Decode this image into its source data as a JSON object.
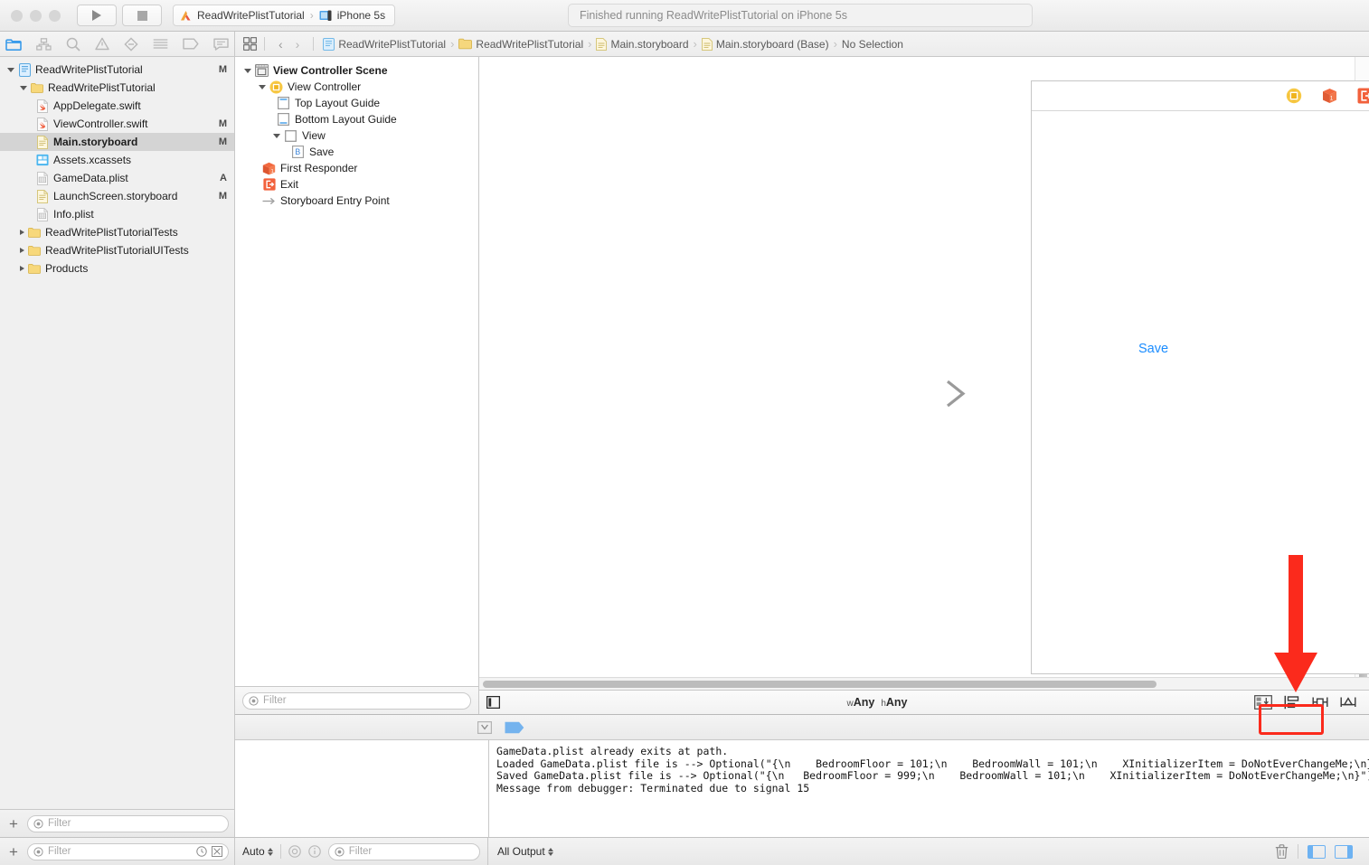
{
  "titlebar": {
    "scheme_project": "ReadWritePlistTutorial",
    "scheme_device": "iPhone 5s",
    "status_text": "Finished running ReadWritePlistTutorial on iPhone 5s",
    "run_button": "run-button",
    "stop_button": "stop-button"
  },
  "navigator_toolbar": {
    "items": [
      {
        "name": "folder-icon",
        "label": "Project navigator"
      },
      {
        "name": "hierarchy-icon",
        "label": "Source control navigator"
      },
      {
        "name": "search-icon",
        "label": "Find navigator"
      },
      {
        "name": "warning-triangle-icon",
        "label": "Issue navigator"
      },
      {
        "name": "diamond-icon",
        "label": "Test navigator"
      },
      {
        "name": "list-icon",
        "label": "Debug navigator"
      },
      {
        "name": "tag-icon",
        "label": "Breakpoint navigator"
      },
      {
        "name": "speech-bubble-icon",
        "label": "Report navigator"
      }
    ]
  },
  "breadcrumb": {
    "grid_button": "related-items",
    "back": "‹",
    "forward": "›",
    "items": [
      {
        "label": "ReadWritePlistTutorial",
        "icon": "project-icon"
      },
      {
        "label": "ReadWritePlistTutorial",
        "icon": "folder-icon"
      },
      {
        "label": "Main.storyboard",
        "icon": "storyboard-icon"
      },
      {
        "label": "Main.storyboard (Base)",
        "icon": "storyboard-icon"
      },
      {
        "label": "No Selection",
        "icon": "none"
      }
    ]
  },
  "navigator": {
    "filter_placeholder": "Filter",
    "items": [
      {
        "label": "ReadWritePlistTutorial",
        "indent": 0,
        "twisty": "open",
        "icon": "project-icon",
        "badge": "M",
        "selected": false
      },
      {
        "label": "ReadWritePlistTutorial",
        "indent": 1,
        "twisty": "open",
        "icon": "folder-icon",
        "badge": "",
        "selected": false
      },
      {
        "label": "AppDelegate.swift",
        "indent": 2,
        "twisty": "none",
        "icon": "swift-icon",
        "badge": "",
        "selected": false
      },
      {
        "label": "ViewController.swift",
        "indent": 2,
        "twisty": "none",
        "icon": "swift-icon",
        "badge": "M",
        "selected": false
      },
      {
        "label": "Main.storyboard",
        "indent": 2,
        "twisty": "none",
        "icon": "storyboard-icon",
        "badge": "M",
        "selected": true
      },
      {
        "label": "Assets.xcassets",
        "indent": 2,
        "twisty": "none",
        "icon": "assets-icon",
        "badge": "",
        "selected": false
      },
      {
        "label": "GameData.plist",
        "indent": 2,
        "twisty": "none",
        "icon": "plist-icon",
        "badge": "A",
        "selected": false
      },
      {
        "label": "LaunchScreen.storyboard",
        "indent": 2,
        "twisty": "none",
        "icon": "storyboard-icon",
        "badge": "M",
        "selected": false
      },
      {
        "label": "Info.plist",
        "indent": 2,
        "twisty": "none",
        "icon": "plist-icon",
        "badge": "",
        "selected": false
      },
      {
        "label": "ReadWritePlistTutorialTests",
        "indent": 1,
        "twisty": "closed",
        "icon": "folder-icon",
        "badge": "",
        "selected": false
      },
      {
        "label": "ReadWritePlistTutorialUITests",
        "indent": 1,
        "twisty": "closed",
        "icon": "folder-icon",
        "badge": "",
        "selected": false
      },
      {
        "label": "Products",
        "indent": 1,
        "twisty": "closed",
        "icon": "folder-icon",
        "badge": "",
        "selected": false
      }
    ]
  },
  "outline": {
    "filter_placeholder": "Filter",
    "items": [
      {
        "label": "View Controller Scene",
        "indent": 0,
        "twisty": "open",
        "icon": "scene-icon",
        "bold": true
      },
      {
        "label": "View Controller",
        "indent": 1,
        "twisty": "open",
        "icon": "view-controller-icon",
        "bold": false
      },
      {
        "label": "Top Layout Guide",
        "indent": 2,
        "twisty": "none",
        "icon": "top-layout-guide-icon",
        "bold": false
      },
      {
        "label": "Bottom Layout Guide",
        "indent": 2,
        "twisty": "none",
        "icon": "bottom-layout-guide-icon",
        "bold": false
      },
      {
        "label": "View",
        "indent": 2,
        "twisty": "open",
        "icon": "view-icon",
        "bold": false
      },
      {
        "label": "Save",
        "indent": 3,
        "twisty": "none",
        "icon": "button-icon",
        "bold": false
      },
      {
        "label": "First Responder",
        "indent": 1,
        "twisty": "none",
        "icon": "first-responder-icon",
        "bold": false
      },
      {
        "label": "Exit",
        "indent": 1,
        "twisty": "none",
        "icon": "exit-icon",
        "bold": false
      },
      {
        "label": "Storyboard Entry Point",
        "indent": 1,
        "twisty": "none",
        "icon": "entry-point-icon",
        "bold": false
      }
    ]
  },
  "canvas": {
    "save_button_label": "Save",
    "scene_dock": [
      {
        "name": "view-controller-dock-icon"
      },
      {
        "name": "first-responder-dock-icon"
      },
      {
        "name": "exit-dock-icon"
      }
    ],
    "entry_point_arrow": "storyboard-entry-arrow"
  },
  "ib_bottom_bar": {
    "left_icon": "document-outline-toggle",
    "size_class_w_prefix": "w",
    "size_class_w": "Any",
    "size_class_h_prefix": "h",
    "size_class_h": "Any",
    "right_icons": [
      {
        "name": "embed-in-icon",
        "highlighted": true
      },
      {
        "name": "align-icon",
        "highlighted": true
      },
      {
        "name": "pin-icon",
        "highlighted": false
      },
      {
        "name": "resolve-auto-layout-issues-icon",
        "highlighted": false
      }
    ],
    "annotation": {
      "type": "red-arrow-and-box",
      "color": "#fb2a1c"
    }
  },
  "debug": {
    "toolbar": [
      {
        "name": "debug-view-hierarchy-icon"
      },
      {
        "name": "breakpoint-icon"
      }
    ],
    "console_lines": [
      "GameData.plist already exits at path.",
      "Loaded GameData.plist file is --> Optional(\"{\\n    BedroomFloor = 101;\\n    BedroomWall = 101;\\n    XInitializerItem = DoNotEverChangeMe;\\n}\")",
      "Saved GameData.plist file is --> Optional(\"{\\n   BedroomFloor = 999;\\n    BedroomWall = 101;\\n    XInitializerItem = DoNotEverChangeMe;\\n}\")",
      "Message from debugger: Terminated due to signal 15"
    ]
  },
  "statusbar": {
    "add_button": "+",
    "nav_filter_placeholder": "Filter",
    "recent_icon": "clock-icon",
    "source_control_icon": "source-control-filter-icon",
    "scope_popup": "Auto",
    "target_icon": "target-icon",
    "info_icon": "info-icon",
    "debug_filter_placeholder": "Filter",
    "output_popup": "All Output",
    "trash_icon": "trash-icon",
    "left_pane_toggle": "variables-pane-toggle",
    "right_pane_toggle": "console-pane-toggle"
  }
}
